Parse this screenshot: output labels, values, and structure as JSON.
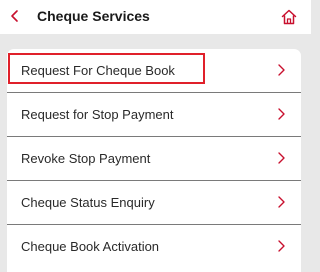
{
  "header": {
    "title": "Cheque Services",
    "back_icon": "chevron-left-icon",
    "home_icon": "home-icon",
    "accent_color": "#c8102e"
  },
  "menu": {
    "items": [
      {
        "label": "Request For Cheque Book",
        "highlighted": true
      },
      {
        "label": "Request for Stop Payment",
        "highlighted": false
      },
      {
        "label": "Revoke Stop Payment",
        "highlighted": false
      },
      {
        "label": "Cheque Status Enquiry",
        "highlighted": false
      },
      {
        "label": "Cheque Book Activation",
        "highlighted": false
      }
    ],
    "chevron_icon": "chevron-right-icon",
    "highlight_color": "#e0202a"
  }
}
